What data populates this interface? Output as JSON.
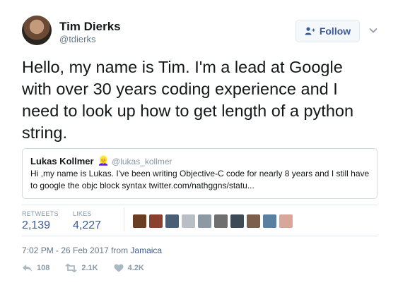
{
  "author": {
    "name": "Tim Dierks",
    "handle": "@tdierks"
  },
  "follow_button": {
    "label": "Follow",
    "icon": "add-user-icon"
  },
  "tweet": {
    "text": "Hello, my name is Tim. I'm a lead at Google with over 30 years coding experience and I need to look up how to get length of a python string."
  },
  "quoted_tweet": {
    "name": "Lukas Kollmer",
    "emoji": "👱‍♀️",
    "handle": "@lukas_kollmer",
    "text": "Hi ,my name is Lukas. I've been writing Objective-C code for nearly 8 years and I still have to google the objc block syntax twitter.com/nathggns/statu..."
  },
  "stats": {
    "retweets_label": "RETWEETS",
    "retweets_value": "2,139",
    "likes_label": "LIKES",
    "likes_value": "4,227"
  },
  "likers": [
    {
      "color": "#6b3e24"
    },
    {
      "color": "#8a3f2f"
    },
    {
      "color": "#4a5e74"
    },
    {
      "color": "#b9bfc5"
    },
    {
      "color": "#8e9aa3"
    },
    {
      "color": "#6f6f6f"
    },
    {
      "color": "#3e4a55"
    },
    {
      "color": "#7d5d4c"
    },
    {
      "color": "#5b7fa0"
    },
    {
      "color": "#d8a79a"
    }
  ],
  "meta": {
    "time": "7:02 PM - 26 Feb 2017 from",
    "location": "Jamaica"
  },
  "actions": {
    "reply_count": "108",
    "retweet_count": "2.1K",
    "like_count": "4.2K"
  },
  "colors": {
    "link": "#3b5999",
    "muted": "#8899a6"
  }
}
